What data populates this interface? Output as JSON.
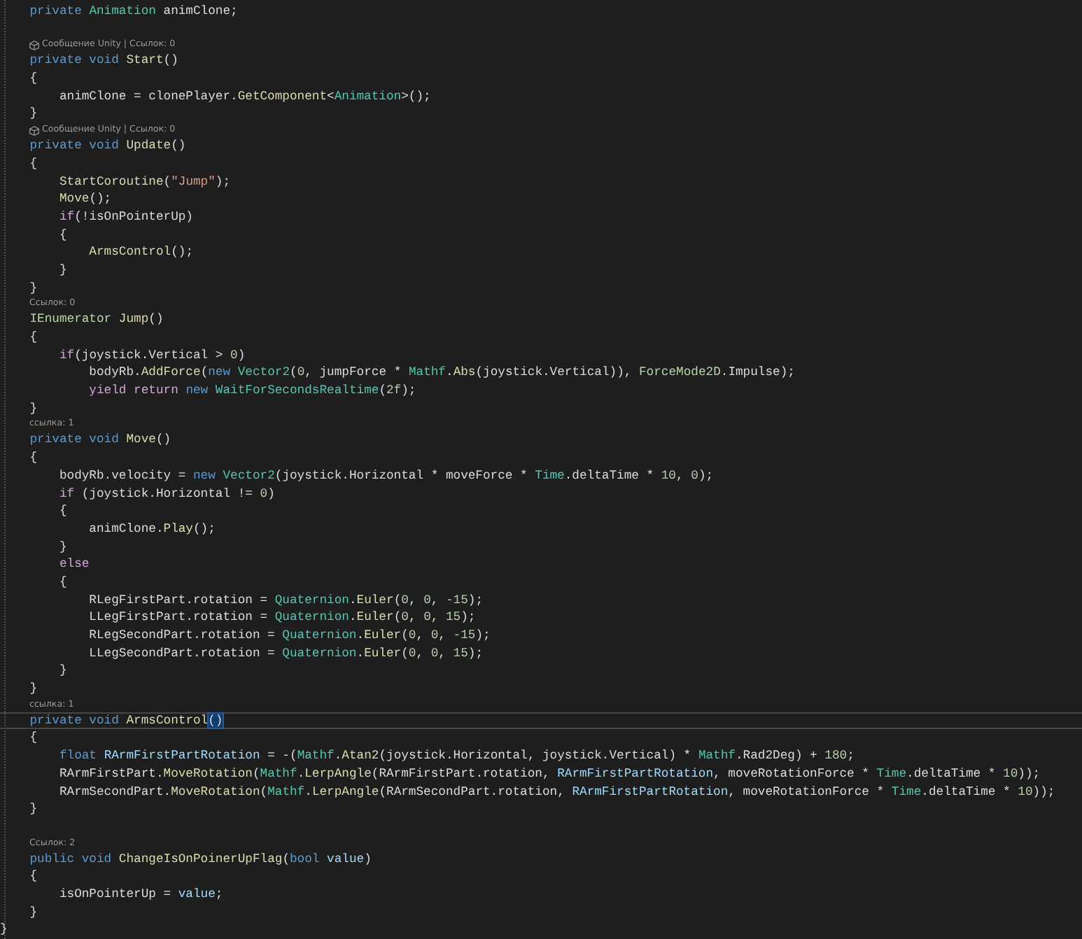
{
  "editor": {
    "lines": [
      {
        "kind": "code",
        "current": false,
        "segments": [
          {
            "text": "    private ",
            "kind": "kw"
          },
          {
            "text": "Animation",
            "kind": "type"
          },
          {
            "text": " animClone;",
            "kind": "txt"
          }
        ]
      },
      {
        "kind": "blank"
      },
      {
        "kind": "lens",
        "unity": true,
        "text": "Сообщение Unity | Ссылок: 0"
      },
      {
        "kind": "code",
        "current": false,
        "segments": [
          {
            "text": "    private void ",
            "kind": "kw"
          },
          {
            "text": "Start",
            "kind": "fn"
          },
          {
            "text": "()",
            "kind": "txt"
          }
        ]
      },
      {
        "kind": "code",
        "current": false,
        "segments": [
          {
            "text": "    {",
            "kind": "txt"
          }
        ]
      },
      {
        "kind": "code",
        "current": false,
        "segments": [
          {
            "text": "        animClone = clonePlayer.",
            "kind": "txt"
          },
          {
            "text": "GetComponent",
            "kind": "fn"
          },
          {
            "text": "<",
            "kind": "txt"
          },
          {
            "text": "Animation",
            "kind": "type"
          },
          {
            "text": ">();",
            "kind": "txt"
          }
        ]
      },
      {
        "kind": "code",
        "current": false,
        "segments": [
          {
            "text": "    }",
            "kind": "txt"
          }
        ]
      },
      {
        "kind": "lens",
        "unity": true,
        "text": "Сообщение Unity | Ссылок: 0"
      },
      {
        "kind": "code",
        "current": false,
        "segments": [
          {
            "text": "    private void ",
            "kind": "kw"
          },
          {
            "text": "Update",
            "kind": "fn"
          },
          {
            "text": "()",
            "kind": "txt"
          }
        ]
      },
      {
        "kind": "code",
        "current": false,
        "segments": [
          {
            "text": "    {",
            "kind": "txt"
          }
        ]
      },
      {
        "kind": "code",
        "current": false,
        "segments": [
          {
            "text": "        StartCoroutine",
            "kind": "fn"
          },
          {
            "text": "(",
            "kind": "txt"
          },
          {
            "text": "\"Jump\"",
            "kind": "str"
          },
          {
            "text": ");",
            "kind": "txt"
          }
        ]
      },
      {
        "kind": "code",
        "current": false,
        "segments": [
          {
            "text": "        Move",
            "kind": "fn"
          },
          {
            "text": "();",
            "kind": "txt"
          }
        ]
      },
      {
        "kind": "code",
        "current": false,
        "segments": [
          {
            "text": "        if",
            "kind": "ctl"
          },
          {
            "text": "(!isOnPointerUp)",
            "kind": "txt"
          }
        ]
      },
      {
        "kind": "code",
        "current": false,
        "segments": [
          {
            "text": "        {",
            "kind": "txt"
          }
        ]
      },
      {
        "kind": "code",
        "current": false,
        "segments": [
          {
            "text": "            ArmsControl",
            "kind": "fn"
          },
          {
            "text": "();",
            "kind": "txt"
          }
        ]
      },
      {
        "kind": "code",
        "current": false,
        "segments": [
          {
            "text": "        }",
            "kind": "txt"
          }
        ]
      },
      {
        "kind": "code",
        "current": false,
        "segments": [
          {
            "text": "    }",
            "kind": "txt"
          }
        ]
      },
      {
        "kind": "lens",
        "unity": false,
        "text": "Ссылок: 0"
      },
      {
        "kind": "code",
        "current": false,
        "segments": [
          {
            "text": "    IEnumerator ",
            "kind": "iface"
          },
          {
            "text": "Jump",
            "kind": "fn"
          },
          {
            "text": "()",
            "kind": "txt"
          }
        ]
      },
      {
        "kind": "code",
        "current": false,
        "segments": [
          {
            "text": "    {",
            "kind": "txt"
          }
        ]
      },
      {
        "kind": "code",
        "current": false,
        "segments": [
          {
            "text": "        if",
            "kind": "ctl"
          },
          {
            "text": "(joystick.Vertical > ",
            "kind": "txt"
          },
          {
            "text": "0",
            "kind": "num"
          },
          {
            "text": ")",
            "kind": "txt"
          }
        ]
      },
      {
        "kind": "code",
        "current": false,
        "segments": [
          {
            "text": "            bodyRb.",
            "kind": "txt"
          },
          {
            "text": "AddForce",
            "kind": "fn"
          },
          {
            "text": "(",
            "kind": "txt"
          },
          {
            "text": "new ",
            "kind": "kw"
          },
          {
            "text": "Vector2",
            "kind": "type"
          },
          {
            "text": "(",
            "kind": "txt"
          },
          {
            "text": "0",
            "kind": "num"
          },
          {
            "text": ", jumpForce * ",
            "kind": "txt"
          },
          {
            "text": "Mathf",
            "kind": "type"
          },
          {
            "text": ".",
            "kind": "txt"
          },
          {
            "text": "Abs",
            "kind": "fn"
          },
          {
            "text": "(joystick.Vertical)), ",
            "kind": "txt"
          },
          {
            "text": "ForceMode2D",
            "kind": "iface"
          },
          {
            "text": ".Impulse);",
            "kind": "txt"
          }
        ]
      },
      {
        "kind": "code",
        "current": false,
        "segments": [
          {
            "text": "            yield return ",
            "kind": "ctl"
          },
          {
            "text": "new ",
            "kind": "kw"
          },
          {
            "text": "WaitForSecondsRealtime",
            "kind": "type"
          },
          {
            "text": "(",
            "kind": "txt"
          },
          {
            "text": "2f",
            "kind": "num"
          },
          {
            "text": ");",
            "kind": "txt"
          }
        ]
      },
      {
        "kind": "code",
        "current": false,
        "segments": [
          {
            "text": "    }",
            "kind": "txt"
          }
        ]
      },
      {
        "kind": "lens",
        "unity": false,
        "text": "ссылка: 1"
      },
      {
        "kind": "code",
        "current": false,
        "segments": [
          {
            "text": "    private void ",
            "kind": "kw"
          },
          {
            "text": "Move",
            "kind": "fn"
          },
          {
            "text": "()",
            "kind": "txt"
          }
        ]
      },
      {
        "kind": "code",
        "current": false,
        "segments": [
          {
            "text": "    {",
            "kind": "txt"
          }
        ]
      },
      {
        "kind": "code",
        "current": false,
        "segments": [
          {
            "text": "        bodyRb.velocity = ",
            "kind": "txt"
          },
          {
            "text": "new ",
            "kind": "kw"
          },
          {
            "text": "Vector2",
            "kind": "type"
          },
          {
            "text": "(joystick.Horizontal * moveForce * ",
            "kind": "txt"
          },
          {
            "text": "Time",
            "kind": "type"
          },
          {
            "text": ".deltaTime * ",
            "kind": "txt"
          },
          {
            "text": "10",
            "kind": "num"
          },
          {
            "text": ", ",
            "kind": "txt"
          },
          {
            "text": "0",
            "kind": "num"
          },
          {
            "text": ");",
            "kind": "txt"
          }
        ]
      },
      {
        "kind": "code",
        "current": false,
        "segments": [
          {
            "text": "        if",
            "kind": "ctl"
          },
          {
            "text": " (joystick.Horizontal != ",
            "kind": "txt"
          },
          {
            "text": "0",
            "kind": "num"
          },
          {
            "text": ")",
            "kind": "txt"
          }
        ]
      },
      {
        "kind": "code",
        "current": false,
        "segments": [
          {
            "text": "        {",
            "kind": "txt"
          }
        ]
      },
      {
        "kind": "code",
        "current": false,
        "segments": [
          {
            "text": "            animClone.",
            "kind": "txt"
          },
          {
            "text": "Play",
            "kind": "fn"
          },
          {
            "text": "();",
            "kind": "txt"
          }
        ]
      },
      {
        "kind": "code",
        "current": false,
        "segments": [
          {
            "text": "        }",
            "kind": "txt"
          }
        ]
      },
      {
        "kind": "code",
        "current": false,
        "segments": [
          {
            "text": "        else",
            "kind": "ctl"
          }
        ]
      },
      {
        "kind": "code",
        "current": false,
        "segments": [
          {
            "text": "        {",
            "kind": "txt"
          }
        ]
      },
      {
        "kind": "code",
        "current": false,
        "segments": [
          {
            "text": "            RLegFirstPart.rotation = ",
            "kind": "txt"
          },
          {
            "text": "Quaternion",
            "kind": "type"
          },
          {
            "text": ".",
            "kind": "txt"
          },
          {
            "text": "Euler",
            "kind": "fn"
          },
          {
            "text": "(",
            "kind": "txt"
          },
          {
            "text": "0",
            "kind": "num"
          },
          {
            "text": ", ",
            "kind": "txt"
          },
          {
            "text": "0",
            "kind": "num"
          },
          {
            "text": ", ",
            "kind": "txt"
          },
          {
            "text": "-15",
            "kind": "num"
          },
          {
            "text": ");",
            "kind": "txt"
          }
        ]
      },
      {
        "kind": "code",
        "current": false,
        "segments": [
          {
            "text": "            LLegFirstPart.rotation = ",
            "kind": "txt"
          },
          {
            "text": "Quaternion",
            "kind": "type"
          },
          {
            "text": ".",
            "kind": "txt"
          },
          {
            "text": "Euler",
            "kind": "fn"
          },
          {
            "text": "(",
            "kind": "txt"
          },
          {
            "text": "0",
            "kind": "num"
          },
          {
            "text": ", ",
            "kind": "txt"
          },
          {
            "text": "0",
            "kind": "num"
          },
          {
            "text": ", ",
            "kind": "txt"
          },
          {
            "text": "15",
            "kind": "num"
          },
          {
            "text": ");",
            "kind": "txt"
          }
        ]
      },
      {
        "kind": "code",
        "current": false,
        "segments": [
          {
            "text": "            RLegSecondPart.rotation = ",
            "kind": "txt"
          },
          {
            "text": "Quaternion",
            "kind": "type"
          },
          {
            "text": ".",
            "kind": "txt"
          },
          {
            "text": "Euler",
            "kind": "fn"
          },
          {
            "text": "(",
            "kind": "txt"
          },
          {
            "text": "0",
            "kind": "num"
          },
          {
            "text": ", ",
            "kind": "txt"
          },
          {
            "text": "0",
            "kind": "num"
          },
          {
            "text": ", ",
            "kind": "txt"
          },
          {
            "text": "-15",
            "kind": "num"
          },
          {
            "text": ");",
            "kind": "txt"
          }
        ]
      },
      {
        "kind": "code",
        "current": false,
        "segments": [
          {
            "text": "            LLegSecondPart.rotation = ",
            "kind": "txt"
          },
          {
            "text": "Quaternion",
            "kind": "type"
          },
          {
            "text": ".",
            "kind": "txt"
          },
          {
            "text": "Euler",
            "kind": "fn"
          },
          {
            "text": "(",
            "kind": "txt"
          },
          {
            "text": "0",
            "kind": "num"
          },
          {
            "text": ", ",
            "kind": "txt"
          },
          {
            "text": "0",
            "kind": "num"
          },
          {
            "text": ", ",
            "kind": "txt"
          },
          {
            "text": "15",
            "kind": "num"
          },
          {
            "text": ");",
            "kind": "txt"
          }
        ]
      },
      {
        "kind": "code",
        "current": false,
        "segments": [
          {
            "text": "        }",
            "kind": "txt"
          }
        ]
      },
      {
        "kind": "code",
        "current": false,
        "segments": [
          {
            "text": "    }",
            "kind": "txt"
          }
        ]
      },
      {
        "kind": "lens",
        "unity": false,
        "text": "ссылка: 1"
      },
      {
        "kind": "code",
        "current": true,
        "segments": [
          {
            "text": "    private void ",
            "kind": "kw"
          },
          {
            "text": "ArmsControl",
            "kind": "fn"
          },
          {
            "text": "()",
            "kind": "match"
          }
        ]
      },
      {
        "kind": "code",
        "current": false,
        "segments": [
          {
            "text": "    {",
            "kind": "txt"
          }
        ]
      },
      {
        "kind": "code",
        "current": false,
        "segments": [
          {
            "text": "        float ",
            "kind": "kw"
          },
          {
            "text": "RArmFirstPartRotation",
            "kind": "var"
          },
          {
            "text": " = -(",
            "kind": "txt"
          },
          {
            "text": "Mathf",
            "kind": "type"
          },
          {
            "text": ".",
            "kind": "txt"
          },
          {
            "text": "Atan2",
            "kind": "fn"
          },
          {
            "text": "(joystick.Horizontal, joystick.Vertical) * ",
            "kind": "txt"
          },
          {
            "text": "Mathf",
            "kind": "type"
          },
          {
            "text": ".Rad2Deg) + ",
            "kind": "txt"
          },
          {
            "text": "180",
            "kind": "num"
          },
          {
            "text": ";",
            "kind": "txt"
          }
        ]
      },
      {
        "kind": "code",
        "current": false,
        "segments": [
          {
            "text": "        RArmFirstPart.",
            "kind": "txt"
          },
          {
            "text": "MoveRotation",
            "kind": "fn"
          },
          {
            "text": "(",
            "kind": "txt"
          },
          {
            "text": "Mathf",
            "kind": "type"
          },
          {
            "text": ".",
            "kind": "txt"
          },
          {
            "text": "LerpAngle",
            "kind": "fn"
          },
          {
            "text": "(RArmFirstPart.rotation, ",
            "kind": "txt"
          },
          {
            "text": "RArmFirstPartRotation",
            "kind": "var"
          },
          {
            "text": ", moveRotationForce * ",
            "kind": "txt"
          },
          {
            "text": "Time",
            "kind": "type"
          },
          {
            "text": ".deltaTime * ",
            "kind": "txt"
          },
          {
            "text": "10",
            "kind": "num"
          },
          {
            "text": "));",
            "kind": "txt"
          }
        ]
      },
      {
        "kind": "code",
        "current": false,
        "segments": [
          {
            "text": "        RArmSecondPart.",
            "kind": "txt"
          },
          {
            "text": "MoveRotation",
            "kind": "fn"
          },
          {
            "text": "(",
            "kind": "txt"
          },
          {
            "text": "Mathf",
            "kind": "type"
          },
          {
            "text": ".",
            "kind": "txt"
          },
          {
            "text": "LerpAngle",
            "kind": "fn"
          },
          {
            "text": "(RArmSecondPart.rotation, ",
            "kind": "txt"
          },
          {
            "text": "RArmFirstPartRotation",
            "kind": "var"
          },
          {
            "text": ", moveRotationForce * ",
            "kind": "txt"
          },
          {
            "text": "Time",
            "kind": "type"
          },
          {
            "text": ".deltaTime * ",
            "kind": "txt"
          },
          {
            "text": "10",
            "kind": "num"
          },
          {
            "text": "));",
            "kind": "txt"
          }
        ]
      },
      {
        "kind": "code",
        "current": false,
        "segments": [
          {
            "text": "    }",
            "kind": "txt"
          }
        ]
      },
      {
        "kind": "blank"
      },
      {
        "kind": "lens",
        "unity": false,
        "text": "Ссылок: 2"
      },
      {
        "kind": "code",
        "current": false,
        "segments": [
          {
            "text": "    public void ",
            "kind": "kw"
          },
          {
            "text": "ChangeIsOnPoinerUpFlag",
            "kind": "fn"
          },
          {
            "text": "(",
            "kind": "txt"
          },
          {
            "text": "bool ",
            "kind": "kw"
          },
          {
            "text": "value",
            "kind": "var"
          },
          {
            "text": ")",
            "kind": "txt"
          }
        ]
      },
      {
        "kind": "code",
        "current": false,
        "segments": [
          {
            "text": "    {",
            "kind": "txt"
          }
        ]
      },
      {
        "kind": "code",
        "current": false,
        "segments": [
          {
            "text": "        isOnPointerUp = ",
            "kind": "txt"
          },
          {
            "text": "value",
            "kind": "var"
          },
          {
            "text": ";",
            "kind": "txt"
          }
        ]
      },
      {
        "kind": "code",
        "current": false,
        "segments": [
          {
            "text": "    }",
            "kind": "txt"
          }
        ]
      },
      {
        "kind": "code",
        "current": false,
        "segments": [
          {
            "text": "}",
            "kind": "txt"
          }
        ]
      }
    ]
  }
}
